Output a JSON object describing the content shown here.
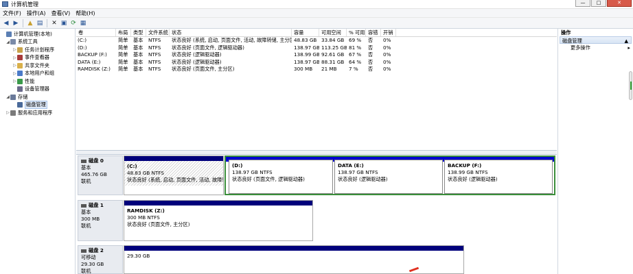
{
  "window": {
    "title": "计算机管理",
    "btn_min": "—",
    "btn_max": "□",
    "btn_close": "✕"
  },
  "menu": [
    "文件(F)",
    "操作(A)",
    "查看(V)",
    "帮助(H)"
  ],
  "toolbar_icons": [
    "back-icon",
    "forward-icon",
    "up-icon",
    "show-hide-tree-icon",
    "delete-icon",
    "properties-icon",
    "refresh-icon",
    "help-icon"
  ],
  "tree": [
    {
      "label": "计算机管理(本地)",
      "level": 0,
      "exp": "",
      "color": "#5b7fb4"
    },
    {
      "label": "系统工具",
      "level": 1,
      "exp": "◢",
      "color": "#7a8aa8"
    },
    {
      "label": "任务计划程序",
      "level": 2,
      "exp": "▷",
      "color": "#c8a24a"
    },
    {
      "label": "事件查看器",
      "level": 2,
      "exp": "▷",
      "color": "#a83a3a"
    },
    {
      "label": "共享文件夹",
      "level": 2,
      "exp": "▷",
      "color": "#d9b04a"
    },
    {
      "label": "本地用户和组",
      "level": 2,
      "exp": "▷",
      "color": "#4a7ac8"
    },
    {
      "label": "性能",
      "level": 2,
      "exp": "▷",
      "color": "#3a9a4a"
    },
    {
      "label": "设备管理器",
      "level": 2,
      "exp": "",
      "color": "#6a6a8a"
    },
    {
      "label": "存储",
      "level": 1,
      "exp": "◢",
      "color": "#6a7a9a"
    },
    {
      "label": "磁盘管理",
      "level": 2,
      "exp": "",
      "color": "#4a6a9a",
      "selected": true
    },
    {
      "label": "服务和应用程序",
      "level": 1,
      "exp": "▷",
      "color": "#7a7a7a"
    }
  ],
  "volumes": {
    "headers": [
      "卷",
      "布局",
      "类型",
      "文件系统",
      "状态",
      "容量",
      "可用空间",
      "% 可用",
      "容错",
      "开销"
    ],
    "rows": [
      [
        "(C:)",
        "简单",
        "基本",
        "NTFS",
        "状态良好 (系统, 启动, 页面文件, 活动, 故障转储, 主分区)",
        "48.83 GB",
        "33.84 GB",
        "69 %",
        "否",
        "0%"
      ],
      [
        "(D:)",
        "简单",
        "基本",
        "NTFS",
        "状态良好 (页面文件, 逻辑驱动器)",
        "138.97 GB",
        "113.25 GB",
        "81 %",
        "否",
        "0%"
      ],
      [
        "BACKUP (F:)",
        "简单",
        "基本",
        "NTFS",
        "状态良好 (逻辑驱动器)",
        "138.99 GB",
        "92.61 GB",
        "67 %",
        "否",
        "0%"
      ],
      [
        "DATA (E:)",
        "简单",
        "基本",
        "NTFS",
        "状态良好 (逻辑驱动器)",
        "138.97 GB",
        "88.31 GB",
        "64 %",
        "否",
        "0%"
      ],
      [
        "RAMDISK (Z:)",
        "简单",
        "基本",
        "NTFS",
        "状态良好 (页面文件, 主分区)",
        "300 MB",
        "21 MB",
        "7 %",
        "否",
        "0%"
      ]
    ]
  },
  "disks": [
    {
      "name": "磁盘 0",
      "type": "基本",
      "size": "465.76 GB",
      "status": "联机",
      "parts": [
        {
          "name": "(C:)",
          "size": "48.83 GB NTFS",
          "status": "状态良好 (系统, 启动, 页面文件, 活动, 故障转储, 主分区)"
        },
        {
          "name": "(D:)",
          "size": "138.97 GB NTFS",
          "status": "状态良好 (页面文件, 逻辑驱动器)"
        },
        {
          "name": "DATA  (E:)",
          "size": "138.97 GB NTFS",
          "status": "状态良好 (逻辑驱动器)"
        },
        {
          "name": "BACKUP  (F:)",
          "size": "138.99 GB NTFS",
          "status": "状态良好 (逻辑驱动器)"
        }
      ]
    },
    {
      "name": "磁盘 1",
      "type": "基本",
      "size": "300 MB",
      "status": "联机",
      "parts": [
        {
          "name": "RAMDISK  (Z:)",
          "size": "300 MB NTFS",
          "status": "状态良好 (页面文件, 主分区)"
        }
      ]
    },
    {
      "name": "磁盘 2",
      "type": "可移动",
      "size": "29.30 GB",
      "status": "联机",
      "parts": [
        {
          "name": "",
          "size": "29.30 GB",
          "status": ""
        }
      ]
    }
  ],
  "actions": {
    "header": "操作",
    "section": "磁盘管理",
    "section_arrow": "▲",
    "more": "更多操作",
    "more_arrow": "▸"
  },
  "colors": {
    "primary_bar": "#00007b",
    "logical_bar": "#0000d0",
    "extended_border": "#3a8e3a"
  }
}
